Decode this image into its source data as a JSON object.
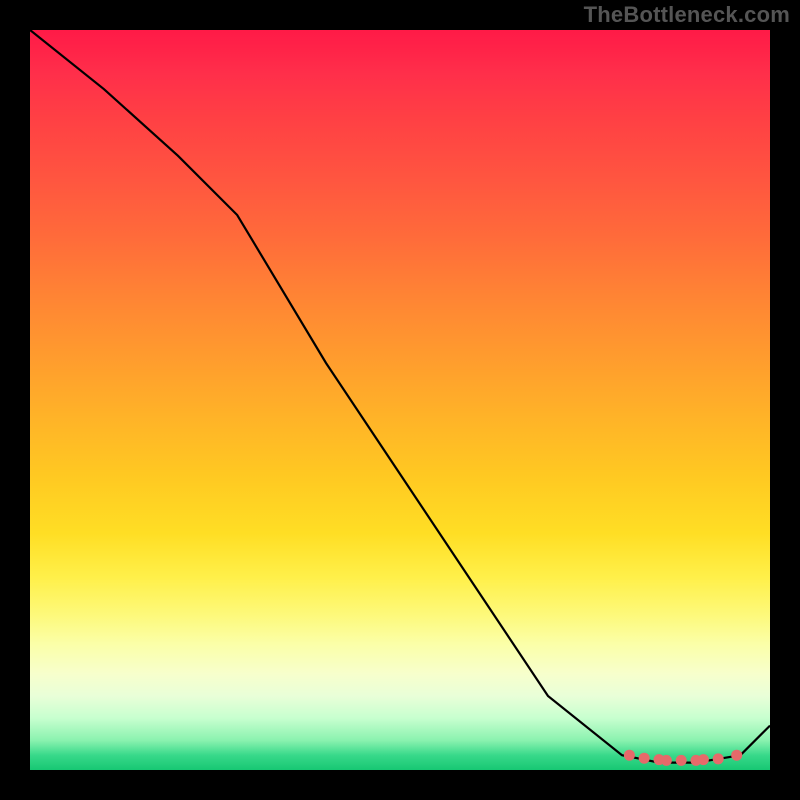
{
  "watermark": "TheBottleneck.com",
  "chart_data": {
    "type": "line",
    "title": "",
    "xlabel": "",
    "ylabel": "",
    "xlim": [
      0,
      100
    ],
    "ylim": [
      0,
      100
    ],
    "series": [
      {
        "name": "curve",
        "x": [
          0,
          10,
          20,
          28,
          40,
          50,
          60,
          70,
          80,
          85,
          90,
          93,
          96,
          100
        ],
        "y": [
          100,
          92,
          83,
          75,
          55,
          40,
          25,
          10,
          2,
          1,
          1,
          1.5,
          2,
          6
        ]
      }
    ],
    "markers": [
      {
        "name": "dot-a",
        "x": 81,
        "y": 2.0
      },
      {
        "name": "dot-b",
        "x": 83,
        "y": 1.6
      },
      {
        "name": "dot-c",
        "x": 85,
        "y": 1.4
      },
      {
        "name": "dot-d",
        "x": 86,
        "y": 1.3
      },
      {
        "name": "dot-e",
        "x": 88,
        "y": 1.3
      },
      {
        "name": "dot-f",
        "x": 90,
        "y": 1.3
      },
      {
        "name": "dot-g",
        "x": 91,
        "y": 1.4
      },
      {
        "name": "dot-h",
        "x": 93,
        "y": 1.5
      },
      {
        "name": "dot-i",
        "x": 95.5,
        "y": 2.0
      }
    ],
    "gradient_stops": [
      {
        "pos": 0,
        "color": "#ff1a47"
      },
      {
        "pos": 20,
        "color": "#ff5540"
      },
      {
        "pos": 44,
        "color": "#ff9b2e"
      },
      {
        "pos": 68,
        "color": "#ffde24"
      },
      {
        "pos": 87,
        "color": "#f7ffcc"
      },
      {
        "pos": 100,
        "color": "#17c773"
      }
    ]
  }
}
